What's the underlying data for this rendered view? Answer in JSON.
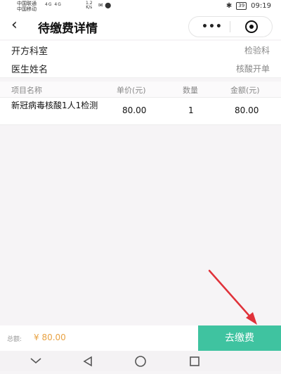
{
  "status": {
    "carrier1": "中国联通",
    "carrier2": "中国移动",
    "net_speed": "1.2",
    "net_unit": "K/s",
    "signal": "4G 4G",
    "icons": "✉ ⬤",
    "bluetooth": "✱",
    "battery": "39",
    "time": "09:19"
  },
  "header": {
    "title": "待缴费详情",
    "back_icon": "‹",
    "more_icon": "•••"
  },
  "info": {
    "dept_label": "开方科室",
    "dept_value": "检验科",
    "doctor_label": "医生姓名",
    "doctor_value": "核酸开单"
  },
  "table": {
    "headers": [
      "项目名称",
      "单价(元)",
      "数量",
      "金额(元)"
    ],
    "rows": [
      {
        "name": "新冠病毒核酸1人1检测",
        "price": "80.00",
        "qty": "1",
        "amount": "80.00"
      }
    ]
  },
  "footer": {
    "total_label": "总额:",
    "total_value": "¥ 80.00",
    "pay_label": "去缴费",
    "accent": "#3fc3a0"
  }
}
